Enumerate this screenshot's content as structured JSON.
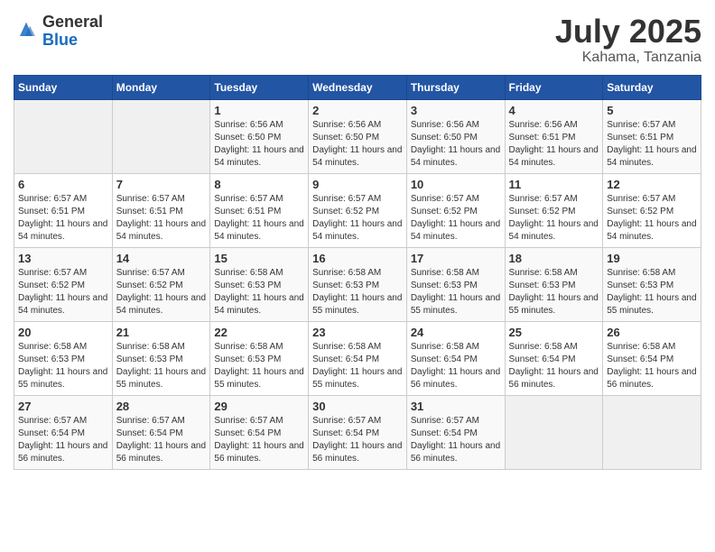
{
  "header": {
    "logo_general": "General",
    "logo_blue": "Blue",
    "month_year": "July 2025",
    "location": "Kahama, Tanzania"
  },
  "days_of_week": [
    "Sunday",
    "Monday",
    "Tuesday",
    "Wednesday",
    "Thursday",
    "Friday",
    "Saturday"
  ],
  "weeks": [
    [
      {
        "day": "",
        "empty": true
      },
      {
        "day": "",
        "empty": true
      },
      {
        "day": "1",
        "sunrise": "6:56 AM",
        "sunset": "6:50 PM",
        "daylight": "Daylight: 11 hours and 54 minutes."
      },
      {
        "day": "2",
        "sunrise": "6:56 AM",
        "sunset": "6:50 PM",
        "daylight": "Daylight: 11 hours and 54 minutes."
      },
      {
        "day": "3",
        "sunrise": "6:56 AM",
        "sunset": "6:50 PM",
        "daylight": "Daylight: 11 hours and 54 minutes."
      },
      {
        "day": "4",
        "sunrise": "6:56 AM",
        "sunset": "6:51 PM",
        "daylight": "Daylight: 11 hours and 54 minutes."
      },
      {
        "day": "5",
        "sunrise": "6:57 AM",
        "sunset": "6:51 PM",
        "daylight": "Daylight: 11 hours and 54 minutes."
      }
    ],
    [
      {
        "day": "6",
        "sunrise": "6:57 AM",
        "sunset": "6:51 PM",
        "daylight": "Daylight: 11 hours and 54 minutes."
      },
      {
        "day": "7",
        "sunrise": "6:57 AM",
        "sunset": "6:51 PM",
        "daylight": "Daylight: 11 hours and 54 minutes."
      },
      {
        "day": "8",
        "sunrise": "6:57 AM",
        "sunset": "6:51 PM",
        "daylight": "Daylight: 11 hours and 54 minutes."
      },
      {
        "day": "9",
        "sunrise": "6:57 AM",
        "sunset": "6:52 PM",
        "daylight": "Daylight: 11 hours and 54 minutes."
      },
      {
        "day": "10",
        "sunrise": "6:57 AM",
        "sunset": "6:52 PM",
        "daylight": "Daylight: 11 hours and 54 minutes."
      },
      {
        "day": "11",
        "sunrise": "6:57 AM",
        "sunset": "6:52 PM",
        "daylight": "Daylight: 11 hours and 54 minutes."
      },
      {
        "day": "12",
        "sunrise": "6:57 AM",
        "sunset": "6:52 PM",
        "daylight": "Daylight: 11 hours and 54 minutes."
      }
    ],
    [
      {
        "day": "13",
        "sunrise": "6:57 AM",
        "sunset": "6:52 PM",
        "daylight": "Daylight: 11 hours and 54 minutes."
      },
      {
        "day": "14",
        "sunrise": "6:57 AM",
        "sunset": "6:52 PM",
        "daylight": "Daylight: 11 hours and 54 minutes."
      },
      {
        "day": "15",
        "sunrise": "6:58 AM",
        "sunset": "6:53 PM",
        "daylight": "Daylight: 11 hours and 54 minutes."
      },
      {
        "day": "16",
        "sunrise": "6:58 AM",
        "sunset": "6:53 PM",
        "daylight": "Daylight: 11 hours and 55 minutes."
      },
      {
        "day": "17",
        "sunrise": "6:58 AM",
        "sunset": "6:53 PM",
        "daylight": "Daylight: 11 hours and 55 minutes."
      },
      {
        "day": "18",
        "sunrise": "6:58 AM",
        "sunset": "6:53 PM",
        "daylight": "Daylight: 11 hours and 55 minutes."
      },
      {
        "day": "19",
        "sunrise": "6:58 AM",
        "sunset": "6:53 PM",
        "daylight": "Daylight: 11 hours and 55 minutes."
      }
    ],
    [
      {
        "day": "20",
        "sunrise": "6:58 AM",
        "sunset": "6:53 PM",
        "daylight": "Daylight: 11 hours and 55 minutes."
      },
      {
        "day": "21",
        "sunrise": "6:58 AM",
        "sunset": "6:53 PM",
        "daylight": "Daylight: 11 hours and 55 minutes."
      },
      {
        "day": "22",
        "sunrise": "6:58 AM",
        "sunset": "6:53 PM",
        "daylight": "Daylight: 11 hours and 55 minutes."
      },
      {
        "day": "23",
        "sunrise": "6:58 AM",
        "sunset": "6:54 PM",
        "daylight": "Daylight: 11 hours and 55 minutes."
      },
      {
        "day": "24",
        "sunrise": "6:58 AM",
        "sunset": "6:54 PM",
        "daylight": "Daylight: 11 hours and 56 minutes."
      },
      {
        "day": "25",
        "sunrise": "6:58 AM",
        "sunset": "6:54 PM",
        "daylight": "Daylight: 11 hours and 56 minutes."
      },
      {
        "day": "26",
        "sunrise": "6:58 AM",
        "sunset": "6:54 PM",
        "daylight": "Daylight: 11 hours and 56 minutes."
      }
    ],
    [
      {
        "day": "27",
        "sunrise": "6:57 AM",
        "sunset": "6:54 PM",
        "daylight": "Daylight: 11 hours and 56 minutes."
      },
      {
        "day": "28",
        "sunrise": "6:57 AM",
        "sunset": "6:54 PM",
        "daylight": "Daylight: 11 hours and 56 minutes."
      },
      {
        "day": "29",
        "sunrise": "6:57 AM",
        "sunset": "6:54 PM",
        "daylight": "Daylight: 11 hours and 56 minutes."
      },
      {
        "day": "30",
        "sunrise": "6:57 AM",
        "sunset": "6:54 PM",
        "daylight": "Daylight: 11 hours and 56 minutes."
      },
      {
        "day": "31",
        "sunrise": "6:57 AM",
        "sunset": "6:54 PM",
        "daylight": "Daylight: 11 hours and 56 minutes."
      },
      {
        "day": "",
        "empty": true
      },
      {
        "day": "",
        "empty": true
      }
    ]
  ]
}
